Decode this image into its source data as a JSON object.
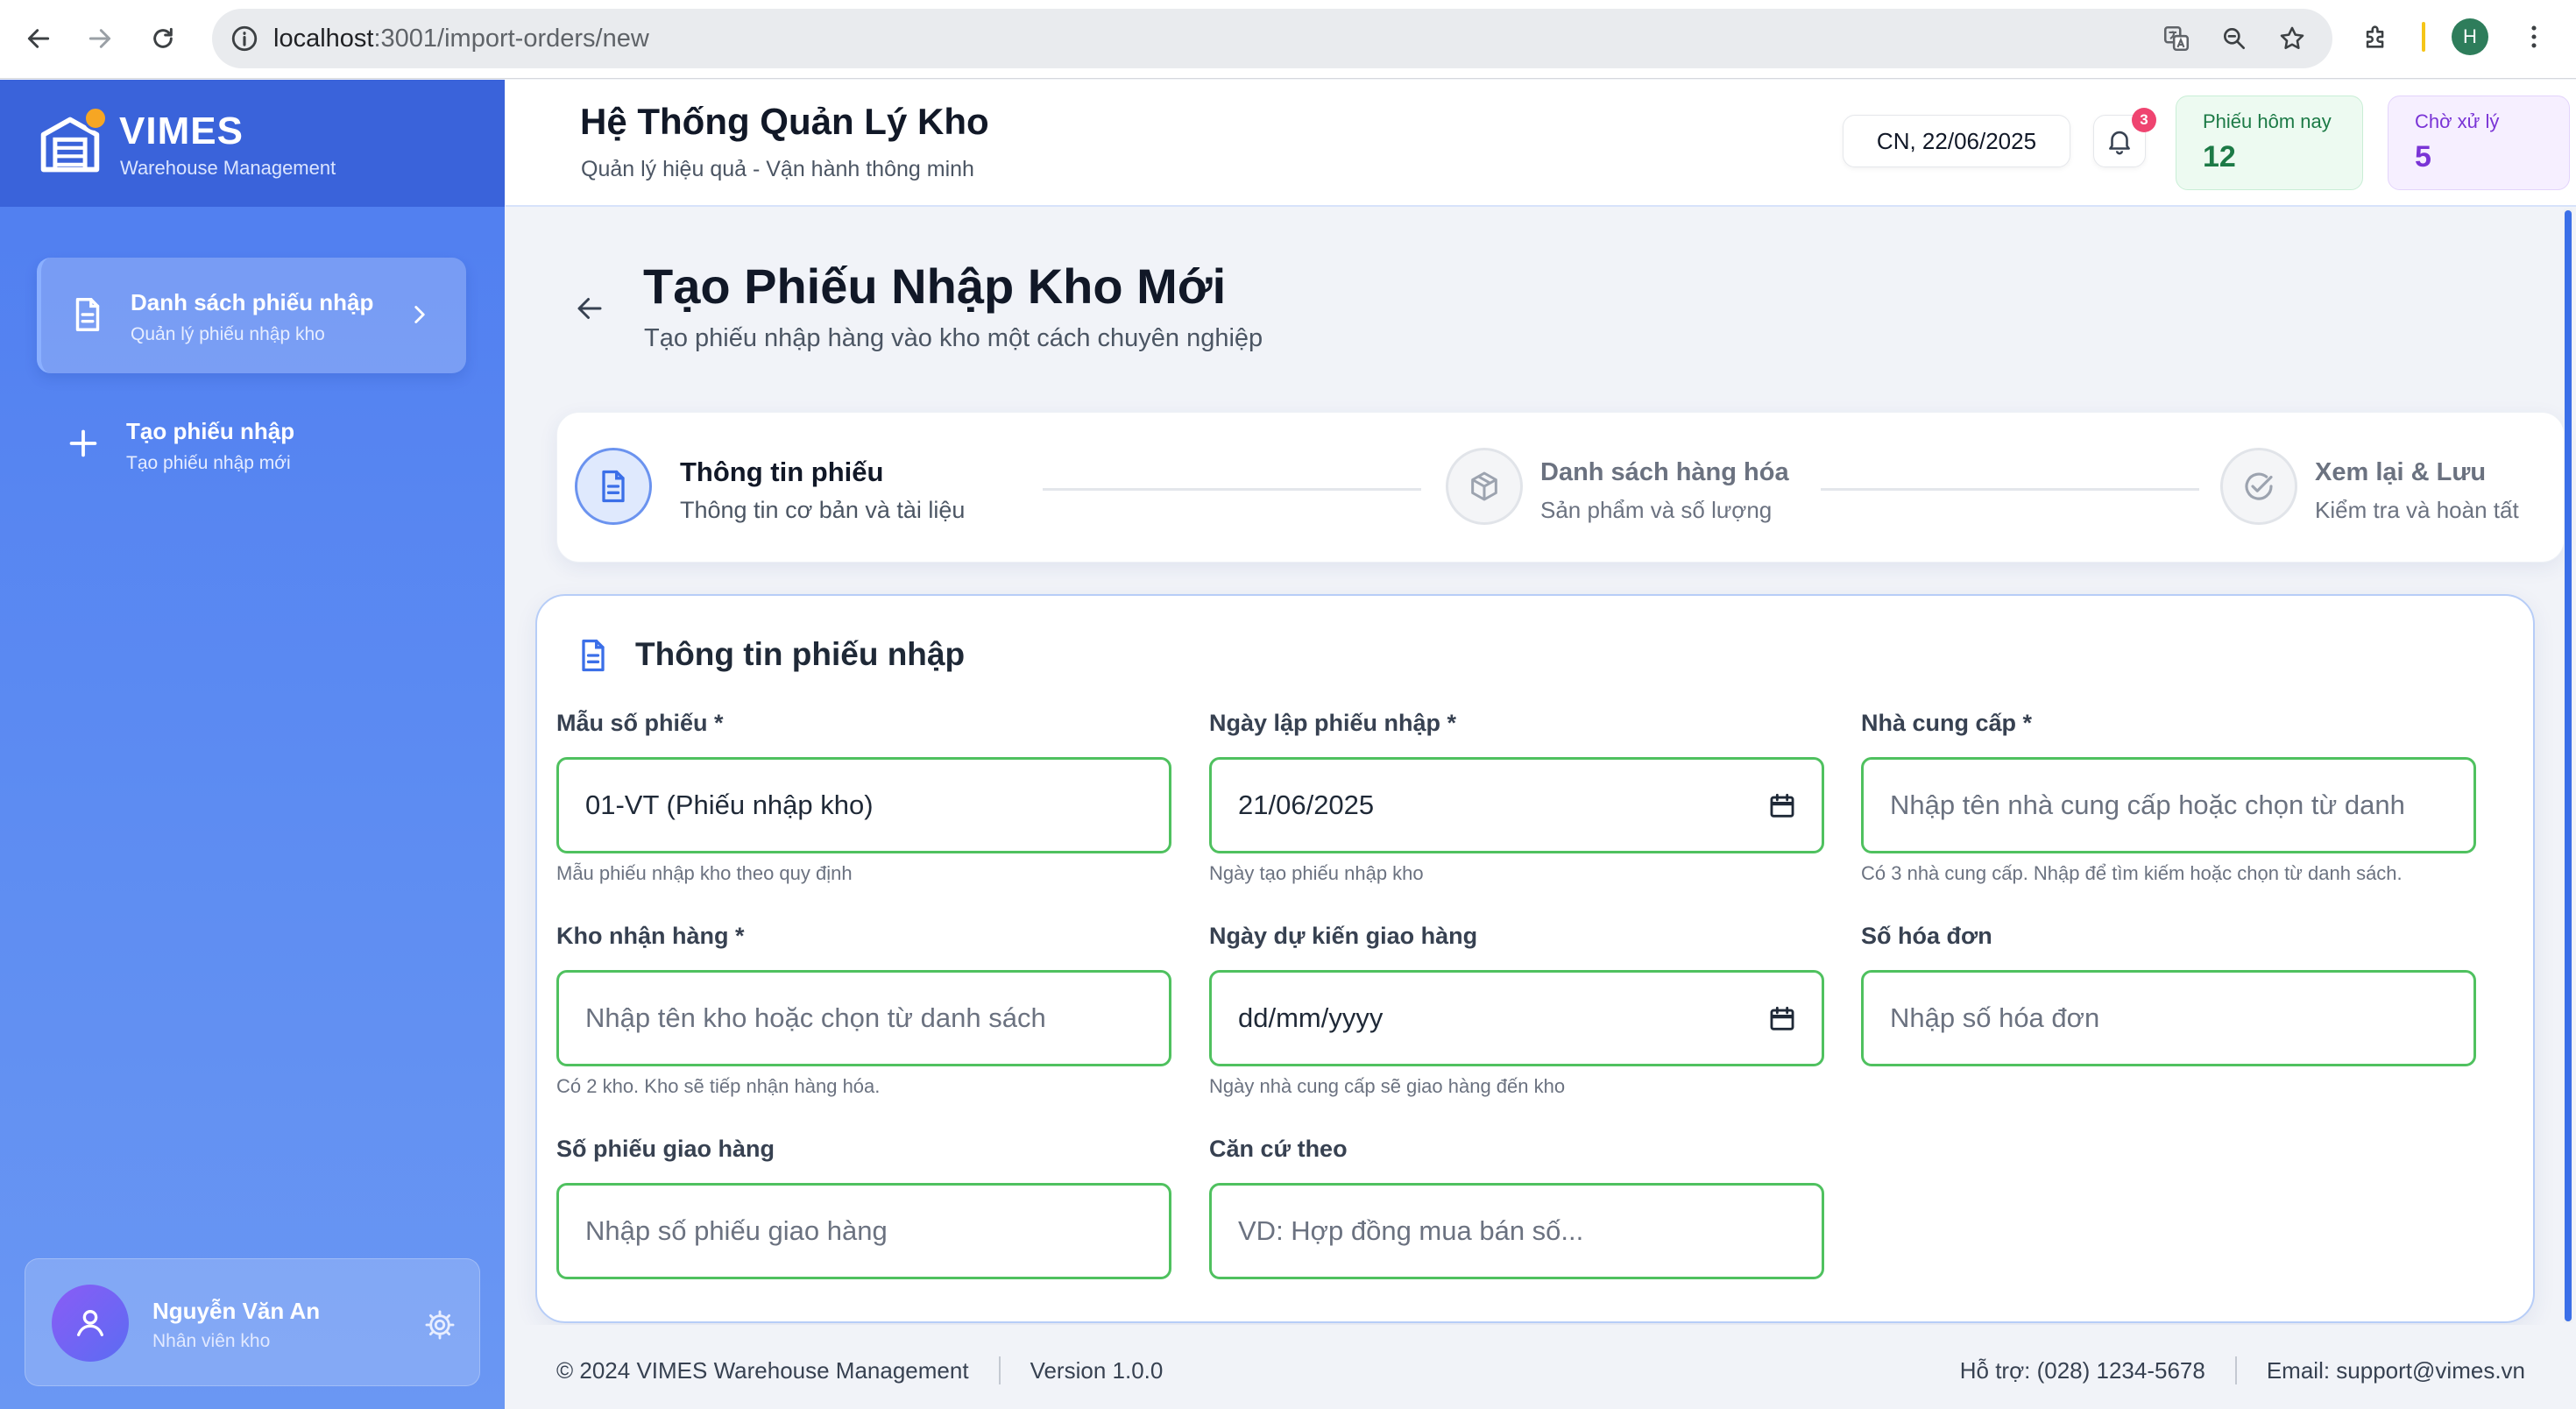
{
  "browser": {
    "url_host": "localhost",
    "url_path": ":3001/import-orders/new",
    "profile_initial": "H"
  },
  "brand": {
    "name": "VIMES",
    "tagline": "Warehouse Management"
  },
  "sidebar": {
    "items": [
      {
        "label": "Danh sách phiếu nhập",
        "sub": "Quản lý phiếu nhập kho",
        "active": true
      },
      {
        "label": "Tạo phiếu nhập",
        "sub": "Tạo phiếu nhập mới",
        "active": false
      }
    ],
    "user": {
      "name": "Nguyễn Văn An",
      "role": "Nhân viên kho"
    }
  },
  "header": {
    "title": "Hệ Thống Quản Lý Kho",
    "subtitle": "Quản lý hiệu quả - Vận hành thông minh",
    "date": "CN, 22/06/2025",
    "notification_count": "3",
    "stats": [
      {
        "label": "Phiếu hôm nay",
        "value": "12",
        "color": "#1c7a46"
      },
      {
        "label": "Chờ xử lý",
        "value": "5",
        "color": "#7a34d6"
      }
    ]
  },
  "page": {
    "title": "Tạo Phiếu Nhập Kho Mới",
    "subtitle": "Tạo phiếu nhập hàng vào kho một cách chuyên nghiệp"
  },
  "steps": [
    {
      "title": "Thông tin phiếu",
      "desc": "Thông tin cơ bản và tài liệu",
      "state": "active",
      "icon": "document-icon"
    },
    {
      "title": "Danh sách hàng hóa",
      "desc": "Sản phẩm và số lượng",
      "state": "pending",
      "icon": "box-icon"
    },
    {
      "title": "Xem lại & Lưu",
      "desc": "Kiểm tra và hoàn tất",
      "state": "pending",
      "icon": "check-circle-icon"
    }
  ],
  "form": {
    "title": "Thông tin phiếu nhập",
    "fields": {
      "template": {
        "label": "Mẫu số phiếu *",
        "value": "01-VT (Phiếu nhập kho)",
        "hint": "Mẫu phiếu nhập kho theo quy định"
      },
      "created_date": {
        "label": "Ngày lập phiếu nhập *",
        "value": "21/06/2025",
        "hint": "Ngày tạo phiếu nhập kho"
      },
      "supplier": {
        "label": "Nhà cung cấp *",
        "placeholder": "Nhập tên nhà cung cấp hoặc chọn từ danh",
        "hint": "Có 3 nhà cung cấp. Nhập để tìm kiếm hoặc chọn từ danh sách."
      },
      "warehouse": {
        "label": "Kho nhận hàng *",
        "placeholder": "Nhập tên kho hoặc chọn từ danh sách",
        "hint": "Có 2 kho. Kho sẽ tiếp nhận hàng hóa."
      },
      "delivery_date": {
        "label": "Ngày dự kiến giao hàng",
        "value": "dd/mm/yyyy",
        "hint": "Ngày nhà cung cấp sẽ giao hàng đến kho"
      },
      "invoice_no": {
        "label": "Số hóa đơn",
        "placeholder": "Nhập số hóa đơn"
      },
      "delivery_no": {
        "label": "Số phiếu giao hàng",
        "placeholder": "Nhập số phiếu giao hàng"
      },
      "based_on": {
        "label": "Căn cứ theo",
        "placeholder": "VD: Hợp đồng mua bán số..."
      }
    }
  },
  "footer": {
    "copyright": "© 2024 VIMES Warehouse Management",
    "version": "Version 1.0.0",
    "support": "Hỗ trợ: (028) 1234-5678",
    "email": "Email: support@vimes.vn"
  },
  "colors": {
    "primary": "#3a63da",
    "field_border": "#4fc15f",
    "badge": "#ef4470"
  }
}
